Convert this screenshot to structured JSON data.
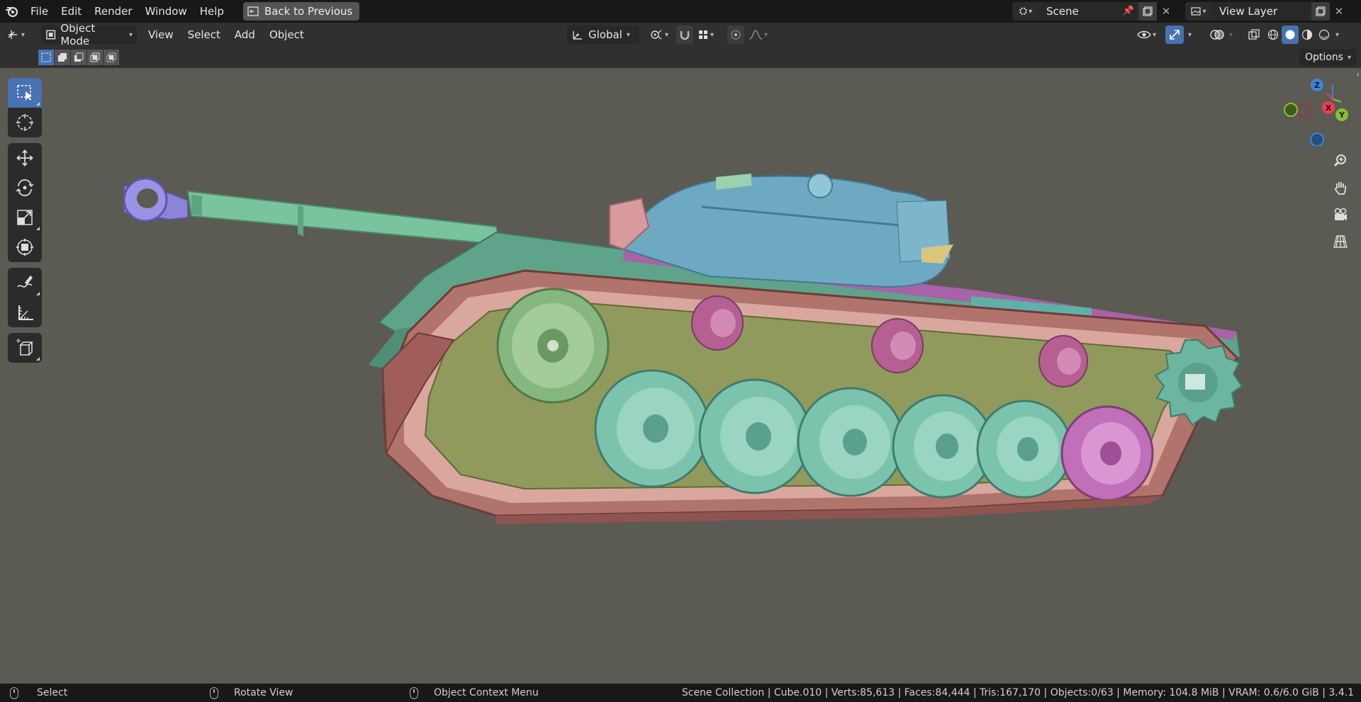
{
  "menubar": {
    "items": [
      "File",
      "Edit",
      "Render",
      "Window",
      "Help"
    ],
    "back_button": "Back to Previous",
    "scene": "Scene",
    "view_layer": "View Layer"
  },
  "header": {
    "mode": "Object Mode",
    "menus": [
      "View",
      "Select",
      "Add",
      "Object"
    ],
    "transform_orientation": "Global"
  },
  "toolrow": {
    "options": "Options"
  },
  "toolbar": {
    "tools": [
      "select-box-icon",
      "cursor-icon",
      "move-icon",
      "rotate-icon",
      "scale-icon",
      "transform-icon",
      "annotate-icon",
      "measure-icon",
      "add-cube-icon"
    ],
    "active": "select-box-icon"
  },
  "gizmo": {
    "x": "X",
    "y": "Y",
    "z": "Z"
  },
  "colors": {
    "accent": "#4772b3",
    "viewport_bg": "#5b5a53",
    "axis_x": "#ee3b53",
    "axis_y": "#84c22a",
    "axis_z": "#3a87d6"
  },
  "statusbar": {
    "left": "Select",
    "middle": "Rotate View",
    "right_hint": "Object Context Menu",
    "info": "Scene Collection | Cube.010 | Verts:85,613 | Faces:84,444 | Tris:167,170 | Objects:0/63 | Memory: 104.8 MiB | VRAM: 0.6/6.0 GiB | 3.4.1"
  }
}
